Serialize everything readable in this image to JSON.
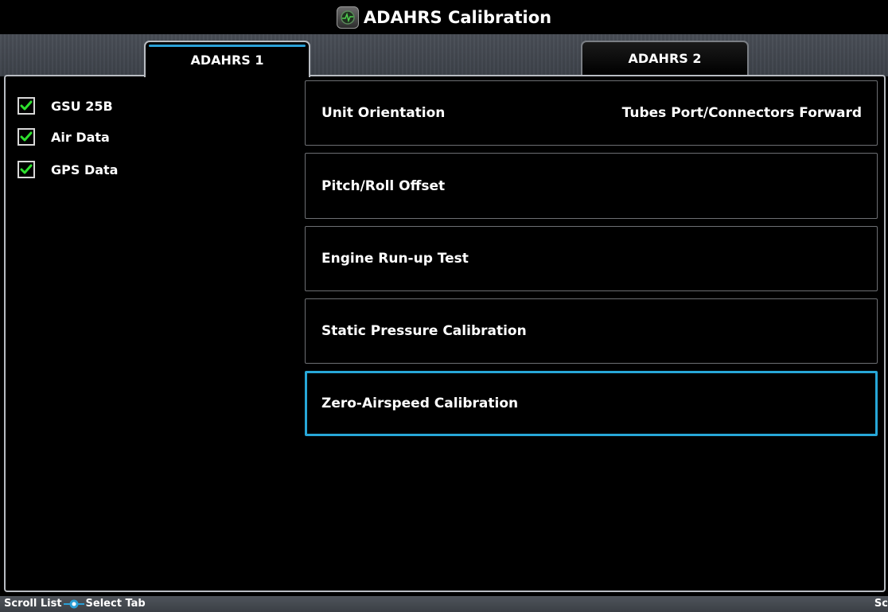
{
  "title": "ADAHRS Calibration",
  "tabs": [
    {
      "label": "ADAHRS 1",
      "active": true
    },
    {
      "label": "ADAHRS 2",
      "active": false
    }
  ],
  "status_items": [
    {
      "label": "GSU 25B",
      "checked": true
    },
    {
      "label": "Air Data",
      "checked": true
    },
    {
      "label": "GPS Data",
      "checked": true
    }
  ],
  "rows": [
    {
      "label": "Unit Orientation",
      "value": "Tubes Port/Connectors Forward"
    },
    {
      "label": "Pitch/Roll Offset",
      "value": ""
    },
    {
      "label": "Engine Run-up Test",
      "value": ""
    },
    {
      "label": "Static Pressure Calibration",
      "value": ""
    },
    {
      "label": "Zero-Airspeed Calibration",
      "value": "",
      "selected": true
    }
  ],
  "softkeys": {
    "left_first": "Scroll List",
    "left_second": "Select Tab",
    "right": "Sc"
  },
  "colors": {
    "accent": "#27a7d8",
    "check": "#2ee02e",
    "background": "#000000"
  },
  "icons": {
    "app": "adahrs-app-icon",
    "check": "checkmark-icon",
    "knob": "knob-icon"
  }
}
